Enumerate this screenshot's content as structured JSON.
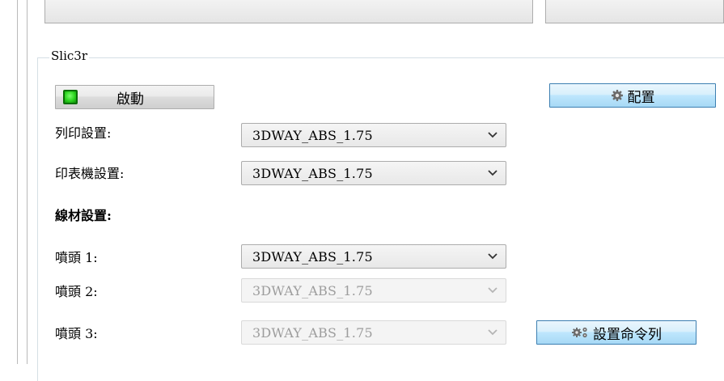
{
  "group": {
    "title": "Slic3r"
  },
  "buttons": {
    "start_label": "啟動",
    "config_label": "配置",
    "cmdline_label": "設置命令列"
  },
  "rows": [
    {
      "label": "列印設置:",
      "value": "3DWAY_ABS_1.75",
      "enabled": true
    },
    {
      "label": "印表機設置:",
      "value": "3DWAY_ABS_1.75",
      "enabled": true
    }
  ],
  "filament": {
    "heading": "線材設置:",
    "extruders": [
      {
        "label": "噴頭 1:",
        "value": "3DWAY_ABS_1.75",
        "enabled": true
      },
      {
        "label": "噴頭 2:",
        "value": "3DWAY_ABS_1.75",
        "enabled": false
      },
      {
        "label": "噴頭 3:",
        "value": "3DWAY_ABS_1.75",
        "enabled": false
      }
    ]
  },
  "icons": {
    "status_led": "green-led-icon",
    "config": "gear-icon",
    "cmdline": "gears-icon",
    "dropdown": "chevron-down-icon"
  },
  "colors": {
    "led_green": "#2ad21e",
    "accent_border": "#3c7fb1"
  }
}
